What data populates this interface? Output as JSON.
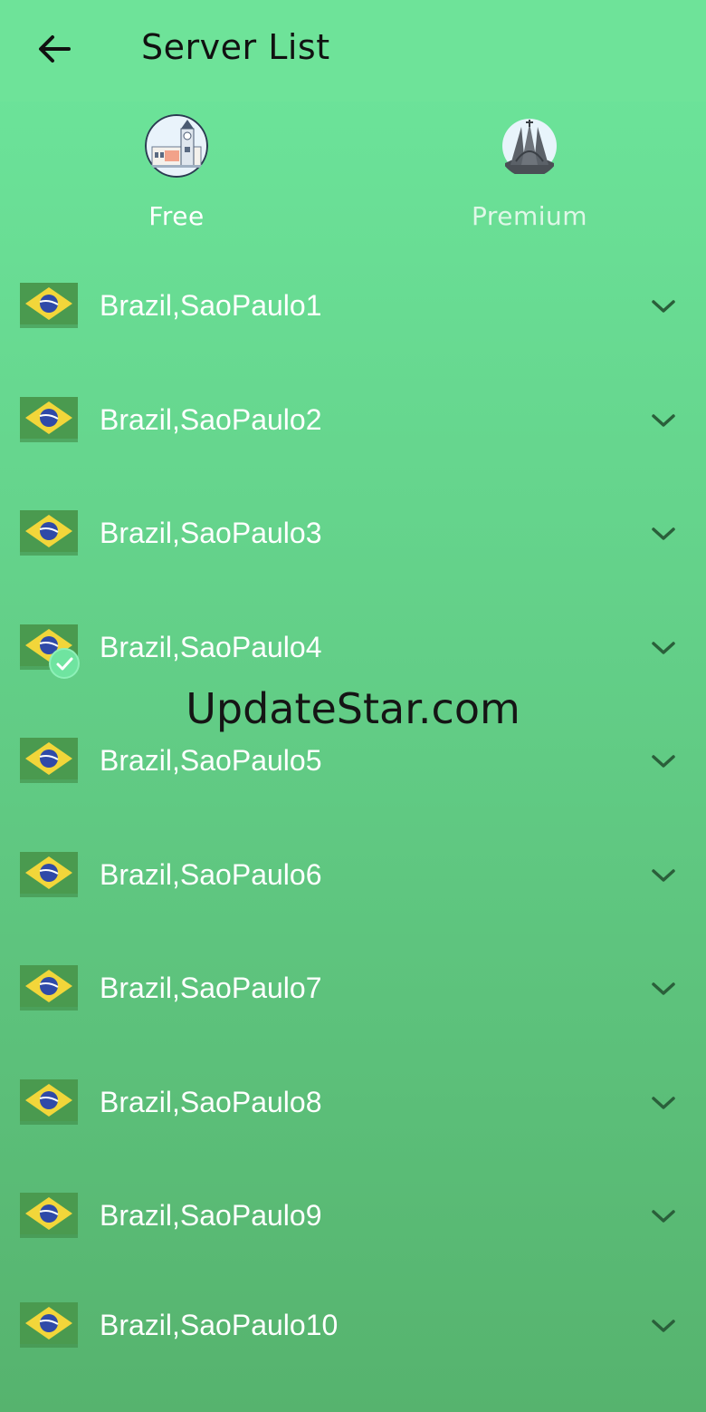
{
  "header": {
    "title": "Server List",
    "back_icon": "arrow-left-icon"
  },
  "tabs": [
    {
      "label": "Free",
      "icon": "city-hall-icon",
      "selected": true
    },
    {
      "label": "Premium",
      "icon": "cathedral-icon",
      "selected": false
    }
  ],
  "servers": [
    {
      "name": "Brazil,SaoPaulo1",
      "flag": "brazil-flag-icon"
    },
    {
      "name": "Brazil,SaoPaulo2",
      "flag": "brazil-flag-icon"
    },
    {
      "name": "Brazil,SaoPaulo3",
      "flag": "brazil-flag-icon"
    },
    {
      "name": "Brazil,SaoPaulo4",
      "flag": "brazil-flag-icon",
      "selected": true
    },
    {
      "name": "Brazil,SaoPaulo5",
      "flag": "brazil-flag-icon"
    },
    {
      "name": "Brazil,SaoPaulo6",
      "flag": "brazil-flag-icon"
    },
    {
      "name": "Brazil,SaoPaulo7",
      "flag": "brazil-flag-icon"
    },
    {
      "name": "Brazil,SaoPaulo8",
      "flag": "brazil-flag-icon"
    },
    {
      "name": "Brazil,SaoPaulo9",
      "flag": "brazil-flag-icon"
    },
    {
      "name": "Brazil,SaoPaulo10",
      "flag": "brazil-flag-icon"
    }
  ],
  "watermark": "UpdateStar.com",
  "colors": {
    "background_top": "#6de69c",
    "background_bottom": "#56b36e",
    "text": "#ffffff",
    "flag_green": "#4a9a4f",
    "flag_yellow": "#f2d63a",
    "flag_blue": "#2f4aa8"
  }
}
